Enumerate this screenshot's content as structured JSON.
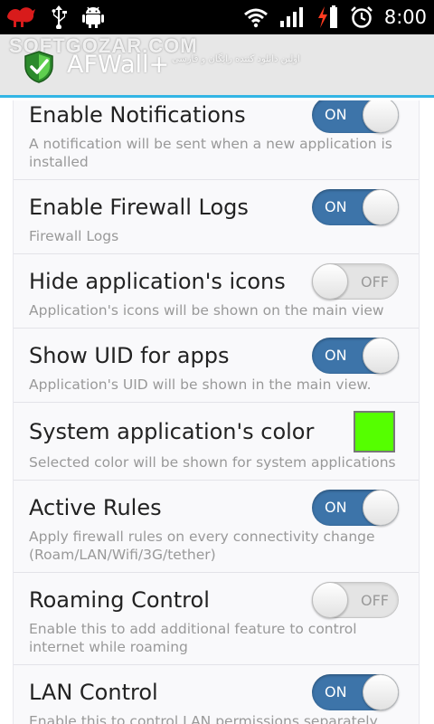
{
  "status_bar": {
    "time": "8:00",
    "left_icons": [
      "notification-app-icon",
      "usb-icon",
      "android-debug-icon"
    ],
    "right_icons": [
      "wifi-icon",
      "signal-icon",
      "battery-charging-icon",
      "alarm-clock-icon"
    ]
  },
  "action_bar": {
    "title": "AFWall+",
    "watermark": "SOFTGOZAR.COM",
    "watermark_sub": "اولین دانلود کننده رایگان و فارسی",
    "accent_color": "#33b5e5"
  },
  "preferences": [
    {
      "title": "Enable Notifications",
      "summary": "A notification will be sent when a new application is installed",
      "control": "toggle",
      "state": "ON"
    },
    {
      "title": "Enable Firewall Logs",
      "summary": "Firewall Logs",
      "control": "toggle",
      "state": "ON"
    },
    {
      "title": "Hide application's icons",
      "summary": "Application's icons will be shown on the main view",
      "control": "toggle",
      "state": "OFF"
    },
    {
      "title": "Show UID for apps",
      "summary": "Application's UID will be shown in the main view.",
      "control": "toggle",
      "state": "ON"
    },
    {
      "title": "System application's color",
      "summary": "Selected color will be shown for system applications",
      "control": "color",
      "color": "#55ff00"
    },
    {
      "title": "Active Rules",
      "summary": "Apply firewall rules on every connectivity change (Roam/LAN/Wifi/3G/tether)",
      "control": "toggle",
      "state": "ON"
    },
    {
      "title": "Roaming Control",
      "summary": "Enable this to add additional feature to control internet while roaming",
      "control": "toggle",
      "state": "OFF"
    },
    {
      "title": "LAN Control",
      "summary": "Enable this to control LAN permissions separately",
      "control": "toggle",
      "state": "ON"
    }
  ],
  "colors": {
    "toggle_on": "#3d74a9",
    "toggle_off": "#e4e4e4"
  }
}
